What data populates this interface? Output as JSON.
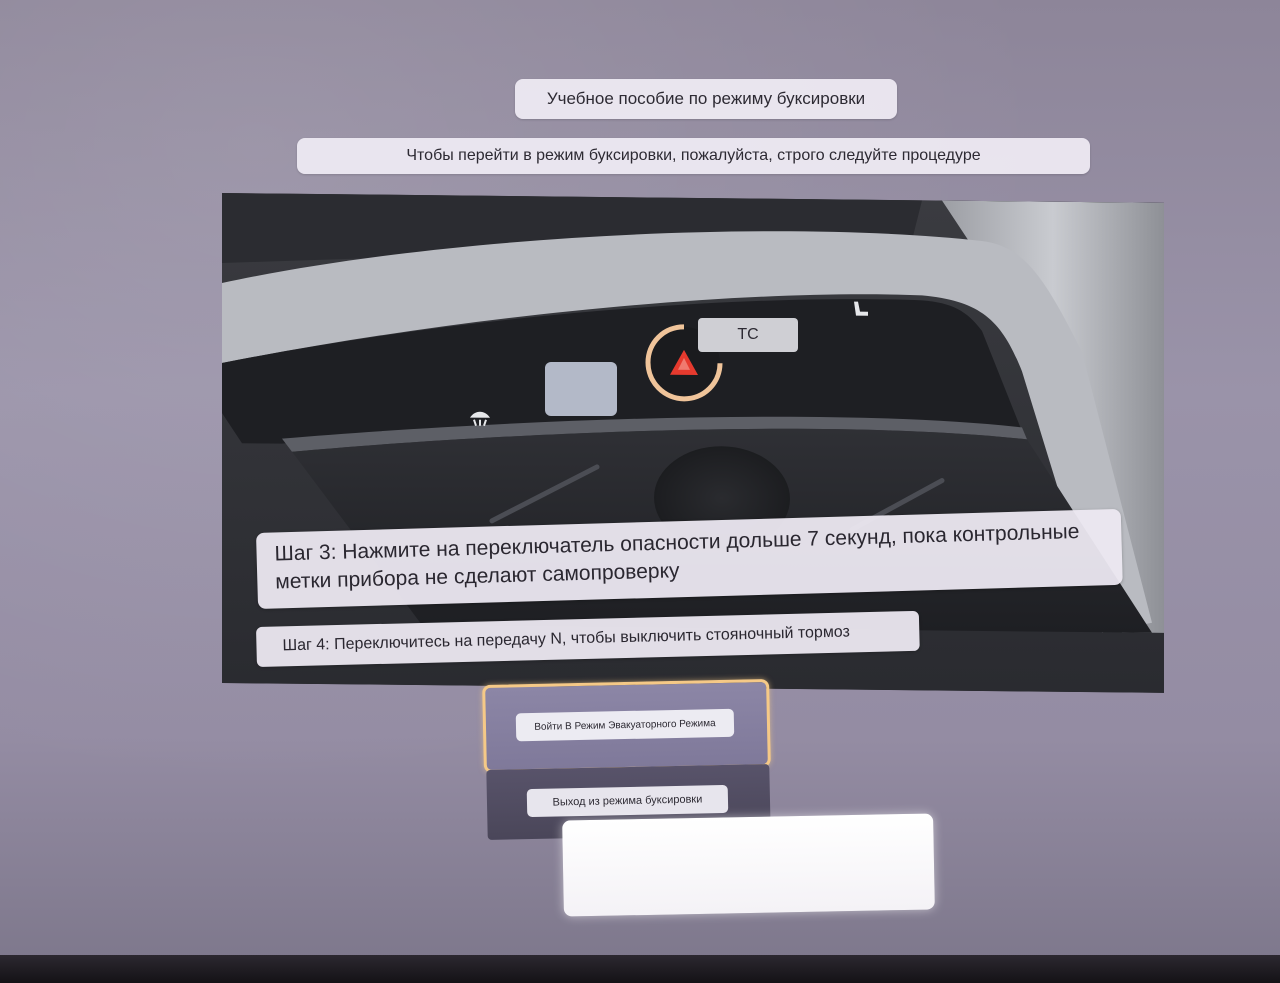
{
  "header": {
    "title": "Учебное пособие по режиму буксировки",
    "subtitle": "Чтобы перейти в режим буксировки, пожалуйста, строго следуйте процедуре"
  },
  "video": {
    "tc_label": "ТС",
    "highlight_color": "#f0c49a",
    "hazard_color": "#e63a2e"
  },
  "steps": {
    "step3": "Шаг 3: Нажмите на переключатель опасности дольше 7 секунд, пока контрольные метки прибора не сделают самопроверку",
    "step4": "Шаг 4: Переключитесь на передачу N, чтобы выключить стояночный тормоз"
  },
  "actions": {
    "enter_label": "Войти В Режим Эвакуаторного Режима",
    "exit_label": "Выход из режима буксировки",
    "selected_border_color": "#f5c987"
  }
}
